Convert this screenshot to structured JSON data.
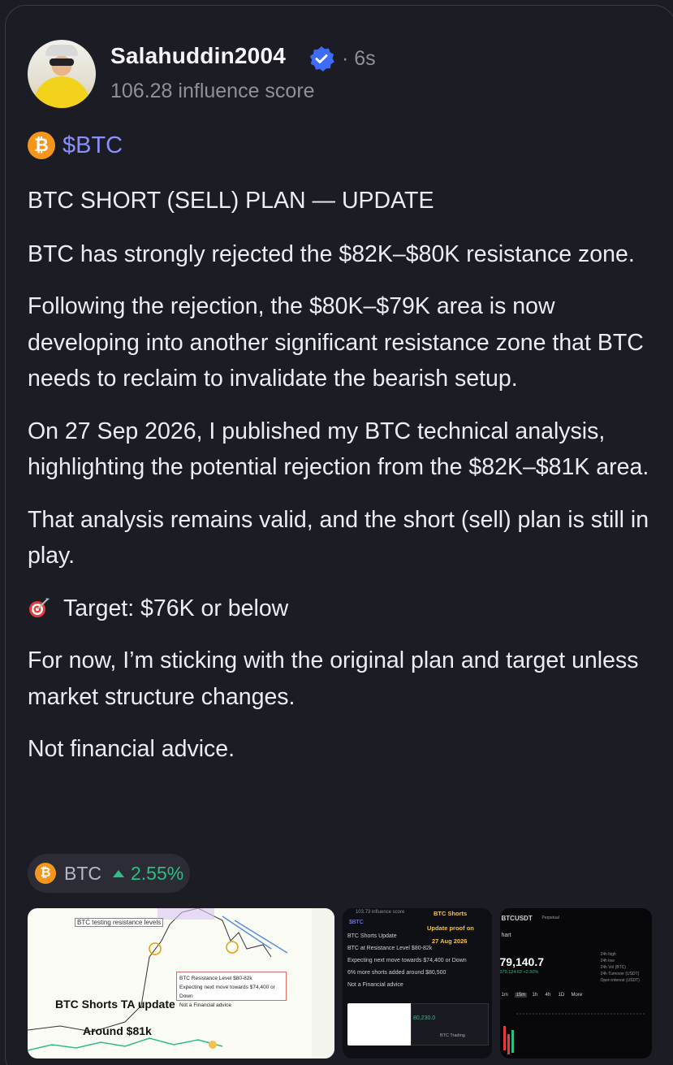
{
  "post": {
    "username": "Salahuddin2004",
    "time": "· 6s",
    "influence": "106.28 influence score",
    "ticker": "$BTC",
    "paragraphs": [
      "BTC SHORT (SELL) PLAN — UPDATE",
      "BTC has strongly rejected the $82K–$80K resistance zone.",
      "Following the rejection, the $80K–$79K area is now developing into another significant resistance zone that BTC needs to reclaim to invalidate the bearish setup.",
      "On 27 Sep 2026, I published my BTC technical analysis, highlighting the potential rejection from the $82K–$81K area.",
      "That analysis remains valid, and the short (sell) plan is still in play.",
      "Target: $76K or below",
      "For now, I’m sticking with the original plan and target unless market structure changes.",
      "Not financial advice."
    ]
  },
  "pill": {
    "symbol": "BTC",
    "change": "2.55%"
  },
  "thumb1": {
    "small_label": "BTC testing resistance levels",
    "note_lines": [
      "BTC Resistance Level $80-82k",
      "Expecting next move towards $74,400 or Down",
      "Not a Financial advice"
    ],
    "big1": "BTC Shorts TA update",
    "big2": "Around $81k"
  },
  "thumb2": {
    "influence": "103.73 influence score",
    "ticker": "$BTC",
    "title": "BTC Shorts",
    "subtitle": "Update proof on",
    "date": "27 Aug 2026",
    "lines": [
      "BTC Shorts Update",
      "BTC at Resistance Level $80-82k",
      "Expecting next move towards $74,400 or Down",
      "6% more shorts added around $80,500",
      "Not a Financial advice"
    ],
    "chart_price": "80,230.0",
    "footer": "BTC Trading"
  },
  "thumb3": {
    "pair": "BTCUSDT",
    "tag": "Perpetual",
    "chart": "hart",
    "price": "79,140.7",
    "sub": "379,124.62  +2.50%",
    "intervals": [
      "1m",
      "15m",
      "1h",
      "4h",
      "1D",
      "More"
    ],
    "stats": [
      "24h high",
      "24h low",
      "24h Vol (BTC)",
      "24h Turnover (USDT)",
      "Open interest (USDT)"
    ]
  }
}
